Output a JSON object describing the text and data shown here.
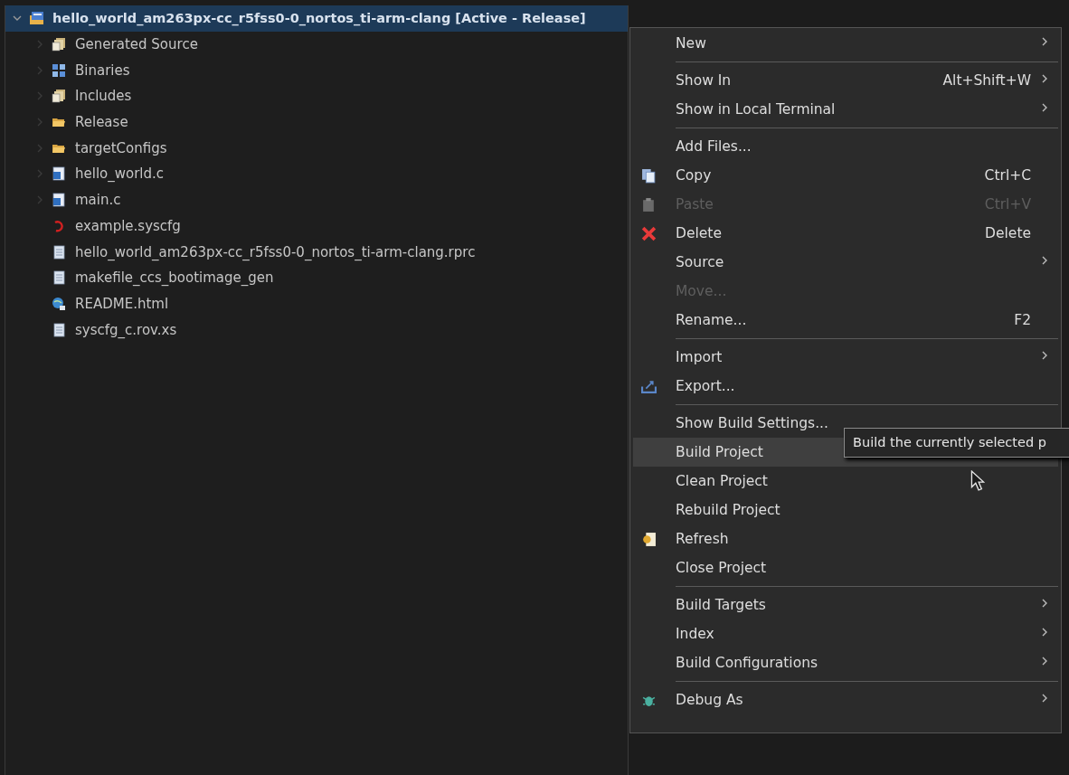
{
  "tree": {
    "label": "hello_world_am263px-cc_r5fss0-0_nortos_ti-arm-clang  [Active - Release]",
    "kind": "project",
    "expanded": true,
    "selected": true,
    "children": [
      {
        "label": "Generated Source",
        "kind": "sourcefolder",
        "expandable": true
      },
      {
        "label": "Binaries",
        "kind": "binaries",
        "expandable": true
      },
      {
        "label": "Includes",
        "kind": "includes",
        "expandable": true
      },
      {
        "label": "Release",
        "kind": "folder",
        "expandable": true
      },
      {
        "label": "targetConfigs",
        "kind": "folder",
        "expandable": true
      },
      {
        "label": "hello_world.c",
        "kind": "cfile",
        "expandable": true
      },
      {
        "label": "main.c",
        "kind": "cfile",
        "expandable": true
      },
      {
        "label": "example.syscfg",
        "kind": "syscfg",
        "expandable": false
      },
      {
        "label": "hello_world_am263px-cc_r5fss0-0_nortos_ti-arm-clang.rprc",
        "kind": "file",
        "expandable": false
      },
      {
        "label": "makefile_ccs_bootimage_gen",
        "kind": "file",
        "expandable": false
      },
      {
        "label": "README.html",
        "kind": "html",
        "expandable": false
      },
      {
        "label": "syscfg_c.rov.xs",
        "kind": "file",
        "expandable": false
      }
    ]
  },
  "context_menu": [
    {
      "kind": "item",
      "label": "New",
      "submenu": true,
      "disabled": false,
      "selected": false
    },
    {
      "kind": "separator"
    },
    {
      "kind": "item",
      "label": "Show In",
      "shortcut": "Alt+Shift+W",
      "submenu": true,
      "disabled": false,
      "selected": false
    },
    {
      "kind": "item",
      "label": "Show in Local Terminal",
      "submenu": true,
      "disabled": false,
      "selected": false
    },
    {
      "kind": "separator"
    },
    {
      "kind": "item",
      "label": "Add Files...",
      "submenu": false,
      "disabled": false,
      "selected": false
    },
    {
      "kind": "copy",
      "label": "Copy",
      "shortcut": "Ctrl+C",
      "submenu": false,
      "disabled": false,
      "selected": false
    },
    {
      "kind": "paste",
      "label": "Paste",
      "shortcut": "Ctrl+V",
      "submenu": false,
      "disabled": true,
      "selected": false
    },
    {
      "kind": "delete",
      "label": "Delete",
      "shortcut": "Delete",
      "submenu": false,
      "disabled": false,
      "selected": false
    },
    {
      "kind": "item",
      "label": "Source",
      "submenu": true,
      "disabled": false,
      "selected": false
    },
    {
      "kind": "item",
      "label": "Move...",
      "submenu": false,
      "disabled": true,
      "selected": false
    },
    {
      "kind": "item",
      "label": "Rename...",
      "shortcut": "F2",
      "submenu": false,
      "disabled": false,
      "selected": false
    },
    {
      "kind": "separator"
    },
    {
      "kind": "item",
      "label": "Import",
      "submenu": true,
      "disabled": false,
      "selected": false
    },
    {
      "kind": "export",
      "label": "Export...",
      "submenu": false,
      "disabled": false,
      "selected": false
    },
    {
      "kind": "separator"
    },
    {
      "kind": "item",
      "label": "Show Build Settings...",
      "submenu": false,
      "disabled": false,
      "selected": false
    },
    {
      "kind": "item",
      "label": "Build Project",
      "submenu": false,
      "disabled": false,
      "selected": true
    },
    {
      "kind": "item",
      "label": "Clean Project",
      "submenu": false,
      "disabled": false,
      "selected": false
    },
    {
      "kind": "item",
      "label": "Rebuild Project",
      "submenu": false,
      "disabled": false,
      "selected": false
    },
    {
      "kind": "refresh",
      "label": "Refresh",
      "submenu": false,
      "disabled": false,
      "selected": false
    },
    {
      "kind": "item",
      "label": "Close Project",
      "submenu": false,
      "disabled": false,
      "selected": false
    },
    {
      "kind": "separator"
    },
    {
      "kind": "item",
      "label": "Build Targets",
      "submenu": true,
      "disabled": false,
      "selected": false
    },
    {
      "kind": "item",
      "label": "Index",
      "submenu": true,
      "disabled": false,
      "selected": false
    },
    {
      "kind": "item",
      "label": "Build Configurations",
      "submenu": true,
      "disabled": false,
      "selected": false
    },
    {
      "kind": "separator"
    },
    {
      "kind": "debug",
      "label": "Debug As",
      "submenu": true,
      "disabled": false,
      "selected": false
    }
  ],
  "tooltip": "Build the currently selected p"
}
